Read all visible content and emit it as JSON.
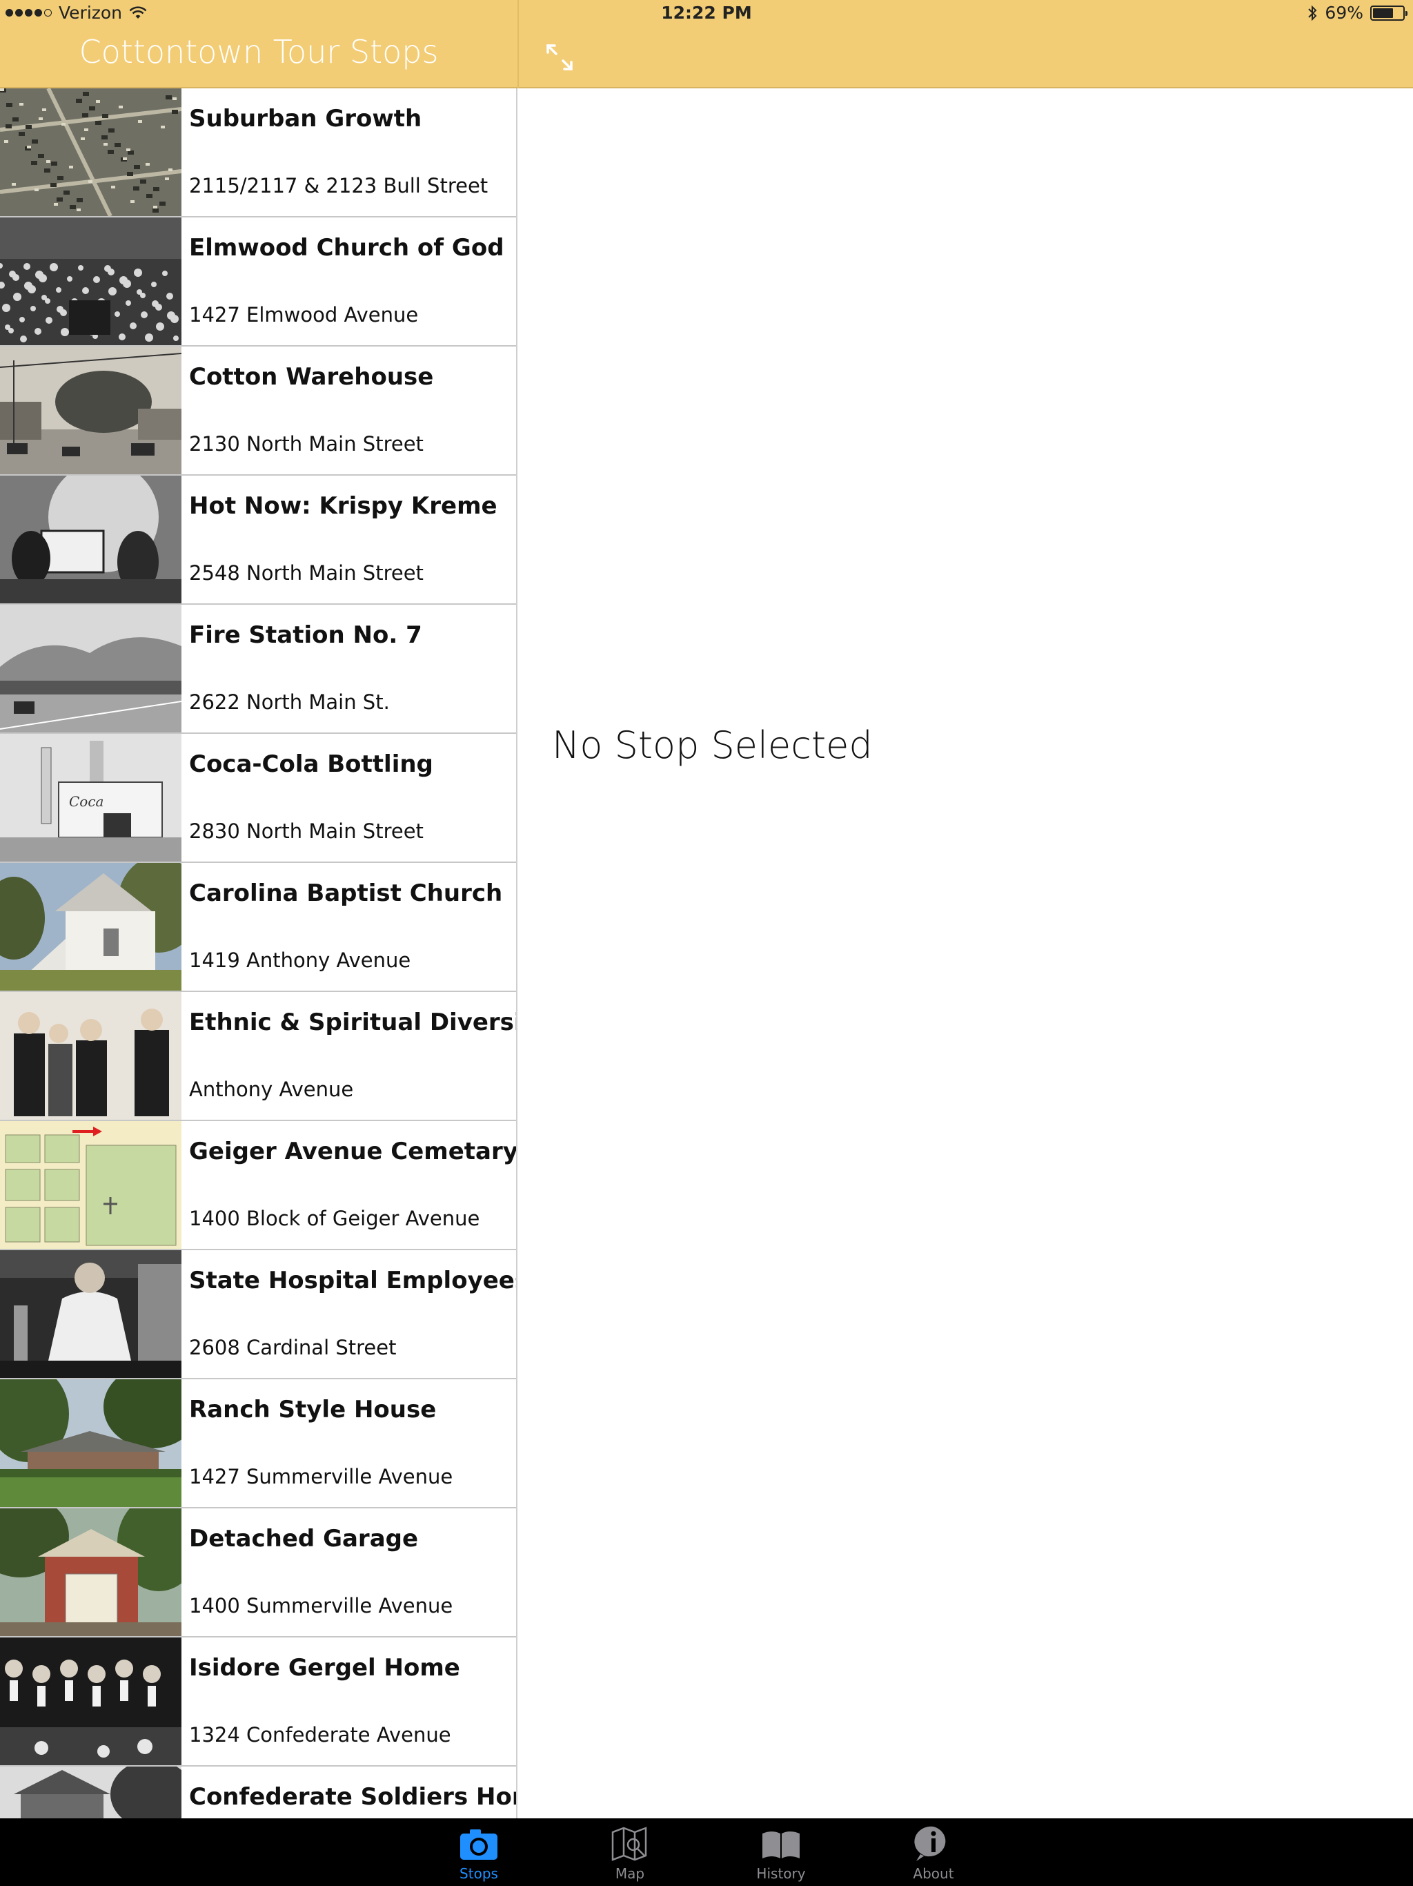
{
  "status_bar": {
    "carrier": "Verizon",
    "time": "12:22 PM",
    "battery_percent": "69%",
    "battery_level": 0.69
  },
  "nav": {
    "title": "Cottontown Tour Stops"
  },
  "stops": [
    {
      "title": "Suburban Growth",
      "address": "2115/2117 & 2123 Bull Street"
    },
    {
      "title": "Elmwood Church of God",
      "address": "1427 Elmwood Avenue"
    },
    {
      "title": "Cotton Warehouse",
      "address": "2130 North Main Street"
    },
    {
      "title": "Hot Now: Krispy Kreme",
      "address": "2548 North Main Street"
    },
    {
      "title": "Fire Station No. 7",
      "address": "2622 North Main St."
    },
    {
      "title": "Coca-Cola Bottling",
      "address": "2830 North Main Street"
    },
    {
      "title": "Carolina Baptist Church",
      "address": "1419 Anthony Avenue"
    },
    {
      "title": "Ethnic & Spiritual Diversity",
      "address": "Anthony Avenue"
    },
    {
      "title": "Geiger Avenue Cemetary",
      "address": "1400 Block of Geiger Avenue"
    },
    {
      "title": "State Hospital Employees",
      "address": "2608 Cardinal Street"
    },
    {
      "title": "Ranch Style House",
      "address": "1427 Summerville Avenue"
    },
    {
      "title": "Detached Garage",
      "address": "1400 Summerville Avenue"
    },
    {
      "title": "Isidore Gergel Home",
      "address": "1324 Confederate Avenue"
    },
    {
      "title": "Confederate Soldiers Home",
      "address": ""
    }
  ],
  "detail": {
    "empty_message": "No Stop Selected"
  },
  "tabs": [
    {
      "label": "Stops",
      "icon": "camera-icon",
      "active": true
    },
    {
      "label": "Map",
      "icon": "map-icon",
      "active": false
    },
    {
      "label": "History",
      "icon": "book-icon",
      "active": false
    },
    {
      "label": "About",
      "icon": "info-icon",
      "active": false
    }
  ],
  "colors": {
    "header_bg": "#f2cd76",
    "tab_active": "#1f8fff",
    "tab_inactive": "#8e8e93"
  }
}
